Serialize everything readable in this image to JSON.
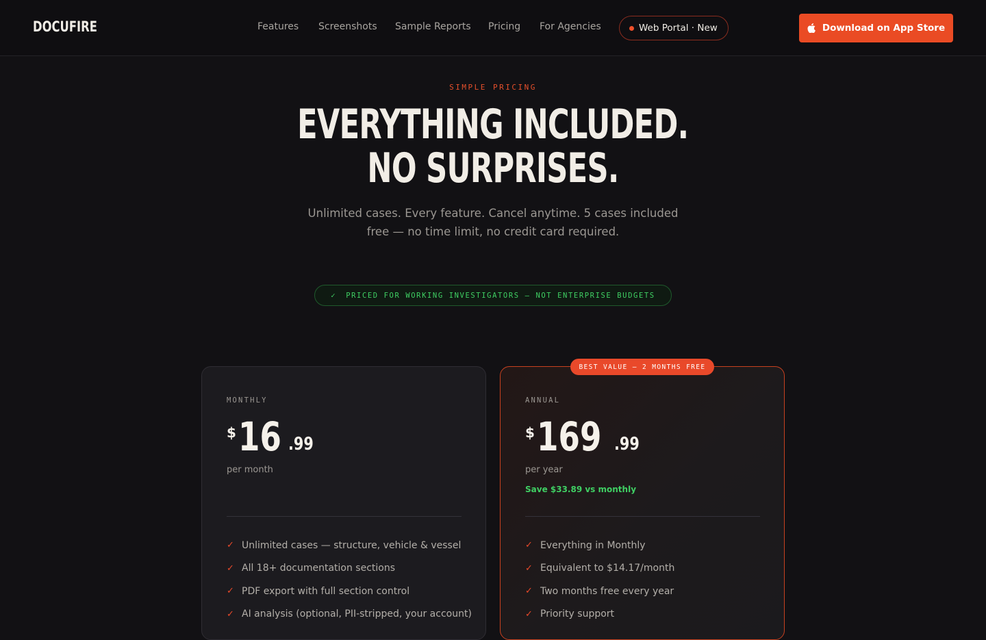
{
  "nav": {
    "logo": "DOCUFIRE",
    "links": [
      "Features",
      "Screenshots",
      "Sample Reports",
      "Pricing",
      "For Agencies"
    ],
    "portal_label": "Web Portal · New",
    "download_label": "Download on App Store"
  },
  "hero": {
    "eyebrow": "SIMPLE PRICING",
    "headline_line1": "EVERYTHING INCLUDED.",
    "headline_line2": "NO SURPRISES.",
    "subhead": "Unlimited cases. Every feature. Cancel anytime. 5 cases included free — no time limit, no credit card required.",
    "priced_pill": "PRICED FOR WORKING INVESTIGATORS — NOT ENTERPRISE BUDGETS",
    "priced_check": "✓"
  },
  "plans": {
    "monthly": {
      "label": "MONTHLY",
      "currency": "$",
      "whole": "16",
      "cents": ".99",
      "period": "per month",
      "features": [
        "Unlimited cases — structure, vehicle & vessel",
        "All 18+ documentation sections",
        "PDF export with full section control",
        "AI analysis (optional, PII-stripped, your account)"
      ]
    },
    "annual": {
      "badge": "BEST VALUE — 2 MONTHS FREE",
      "label": "ANNUAL",
      "currency": "$",
      "whole": "169",
      "cents": ".99",
      "period": "per year",
      "save": "Save $33.89 vs monthly",
      "features": [
        "Everything in Monthly",
        "Equivalent to $14.17/month",
        "Two months free every year",
        "Priority support"
      ]
    },
    "tick": "✓"
  },
  "colors": {
    "accent": "#ea4b24",
    "success": "#3fcf63",
    "background": "#121114"
  }
}
